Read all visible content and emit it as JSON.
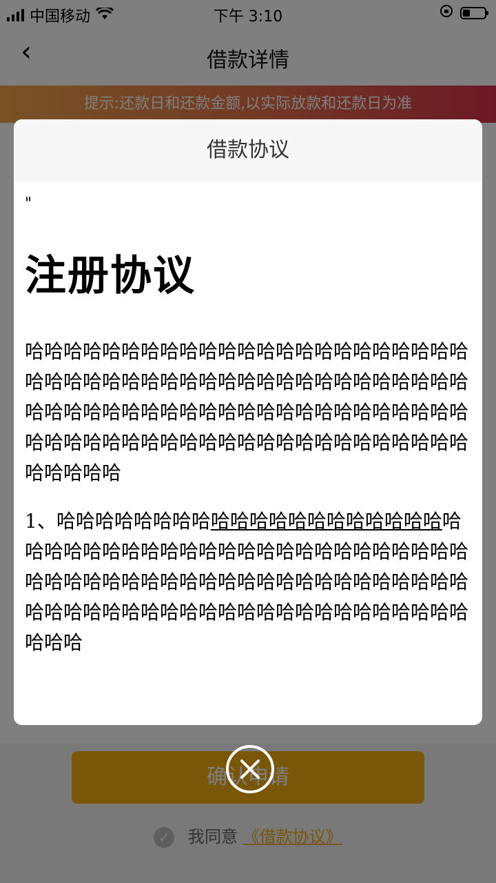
{
  "status": {
    "carrier": "中国移动",
    "time": "下午 3:10"
  },
  "nav": {
    "back_icon": "‹",
    "title": "借款详情"
  },
  "notice": {
    "text": "提示:还款日和还款金额,以实际放款和还款日为准"
  },
  "footer": {
    "confirm_label": "确认申请",
    "agree_prefix": "我同意",
    "agree_link": "《借款协议》"
  },
  "modal": {
    "header": "借款协议",
    "quote": "\"",
    "doc_title": "注册协议",
    "paragraph1": "哈哈哈哈哈哈哈哈哈哈哈哈哈哈哈哈哈哈哈哈哈哈哈哈哈哈哈哈哈哈哈哈哈哈哈哈哈哈哈哈哈哈哈哈哈哈哈哈哈哈哈哈哈哈哈哈哈哈哈哈哈哈哈哈哈哈哈哈哈哈哈哈哈哈哈哈哈哈哈哈哈哈哈哈哈哈哈哈哈哈哈哈哈哈哈哈哈",
    "paragraph2_prefix": "1、哈哈哈哈哈哈哈哈",
    "paragraph2_underlined": "哈哈哈哈哈哈哈哈哈哈哈哈",
    "paragraph2_rest": "哈哈哈哈哈哈哈哈哈哈哈哈哈哈哈哈哈哈哈哈哈哈哈哈哈哈哈哈哈哈哈哈哈哈哈哈哈哈哈哈哈哈哈哈哈哈哈哈哈哈哈哈哈哈哈哈哈哈哈哈哈哈哈哈哈哈哈哈哈哈哈哈哈"
  },
  "close_icon": "close-circle-icon"
}
